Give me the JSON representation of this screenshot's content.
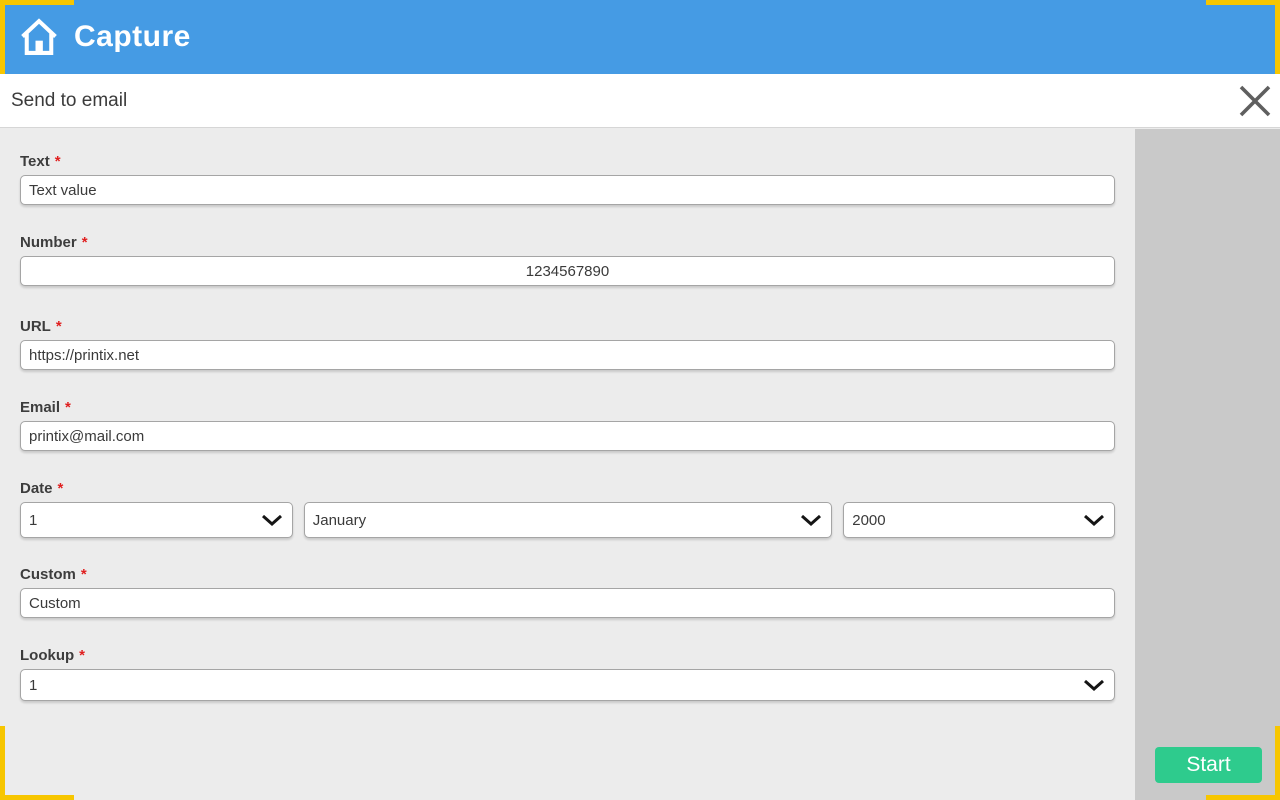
{
  "header": {
    "app_title": "Capture"
  },
  "titlebar": {
    "title": "Send to email"
  },
  "form": {
    "required_mark": "*",
    "fields": [
      {
        "label": "Text",
        "type": "text",
        "value": "Text value",
        "align": "left"
      },
      {
        "label": "Number",
        "type": "text",
        "value": "1234567890",
        "align": "center"
      },
      {
        "label": "URL",
        "type": "text",
        "value": "https://printix.net",
        "align": "left"
      },
      {
        "label": "Email",
        "type": "text",
        "value": "printix@mail.com",
        "align": "left"
      },
      {
        "label": "Date",
        "type": "select-group",
        "values": [
          "1",
          "January",
          "2000"
        ]
      },
      {
        "label": "Custom",
        "type": "text",
        "value": "Custom",
        "align": "left"
      },
      {
        "label": "Lookup",
        "type": "select",
        "value": "1"
      }
    ]
  },
  "footer": {
    "start_label": "Start"
  },
  "icons": {
    "home": "house-outline",
    "close": "x-cross",
    "chevron": "chevron-down"
  },
  "colors": {
    "header_blue": "#459be4",
    "viewfinder_yellow": "#f7c600",
    "start_green": "#2ecb8d",
    "form_background": "#ececec",
    "side_background": "#c9c9c9",
    "required_red": "#e01f1f"
  }
}
